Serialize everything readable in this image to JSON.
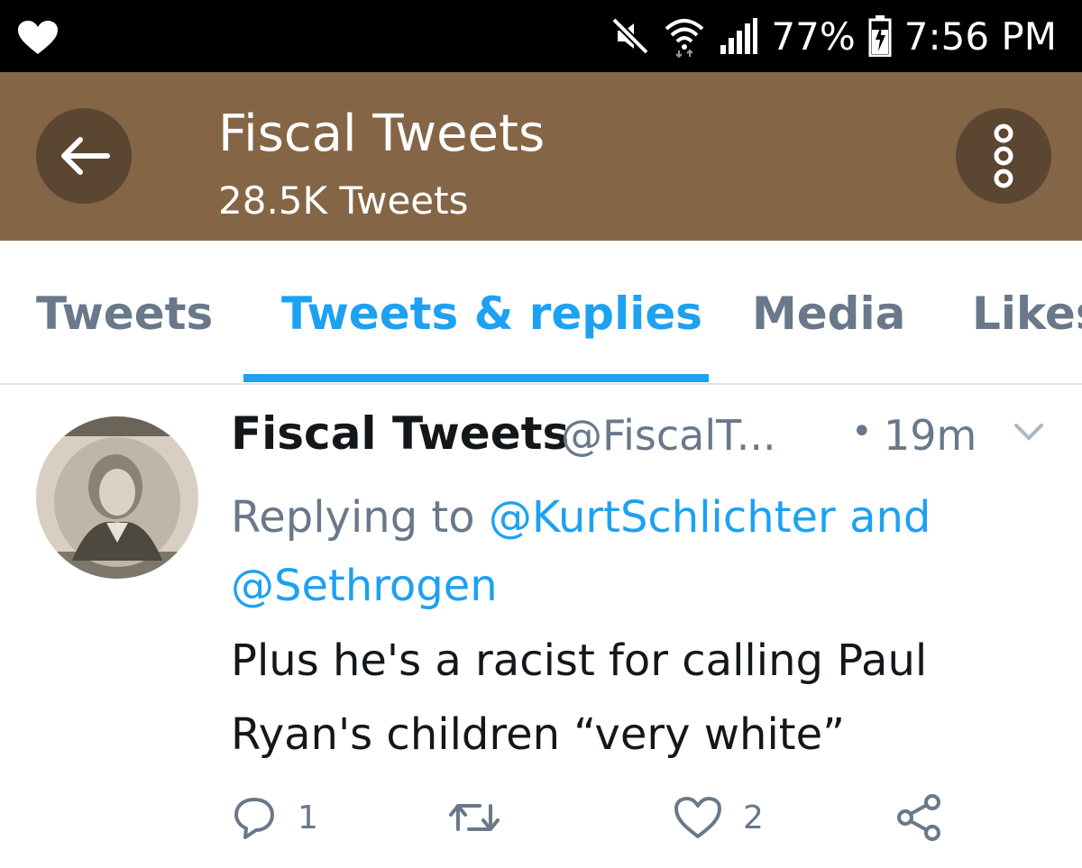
{
  "status_bar": {
    "battery": "77%",
    "time": "7:56 PM",
    "icons": [
      "heart-icon",
      "mute-icon",
      "wifi-icon",
      "signal-icon",
      "battery-charging-icon"
    ]
  },
  "header": {
    "title": "Fiscal Tweets",
    "subtitle": "28.5K Tweets",
    "icons": [
      "back-arrow-icon",
      "more-options-icon"
    ],
    "colors": {
      "background": "#846546",
      "button": "#5b4632"
    }
  },
  "tabs": [
    {
      "label": "Tweets",
      "active": false
    },
    {
      "label": "Tweets & replies",
      "active": true
    },
    {
      "label": "Media",
      "active": false
    },
    {
      "label": "Likes",
      "active": false
    }
  ],
  "tweet": {
    "name": "Fiscal Tweets",
    "handle": "@FiscalT...",
    "separator": "•",
    "time": "19m",
    "replying_prefix": "Replying to",
    "mention1": "@KurtSchlichter",
    "conjunction": "and",
    "mention2": "@Sethrogen",
    "body_line1": "Plus he's a racist for calling Paul",
    "body_line2": "Ryan's children “very white”",
    "actions": {
      "reply_count": "1",
      "retweet_count": "",
      "like_count": "2"
    }
  },
  "colors": {
    "accent": "#1da1f2",
    "muted": "#69788a",
    "text": "#14171a"
  }
}
